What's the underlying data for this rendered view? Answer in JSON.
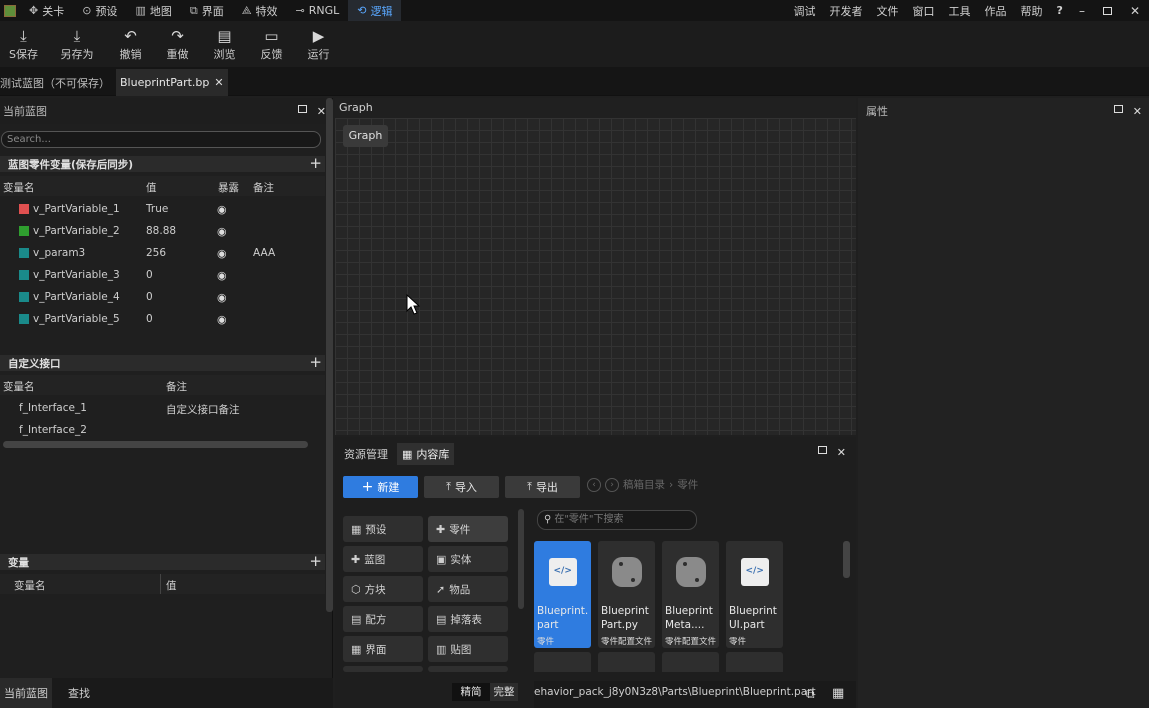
{
  "menubar": {
    "nav": [
      {
        "label": "关卡",
        "icon": "level-icon"
      },
      {
        "label": "预设",
        "icon": "preset-icon"
      },
      {
        "label": "地图",
        "icon": "map-icon"
      },
      {
        "label": "界面",
        "icon": "ui-icon"
      },
      {
        "label": "特效",
        "icon": "effects-icon"
      },
      {
        "label": "RNGL",
        "icon": "rngl-icon"
      },
      {
        "label": "逻辑",
        "icon": "logic-icon"
      }
    ],
    "right": [
      "调试",
      "开发者",
      "文件",
      "窗口",
      "工具",
      "作品",
      "帮助"
    ],
    "help_icon": "?",
    "accent": "#5aa8ff"
  },
  "toolbar": {
    "items": [
      {
        "label": "S保存",
        "icon": "save-icon"
      },
      {
        "label": "另存为",
        "icon": "save-as-icon"
      },
      {
        "label": "撤销",
        "icon": "undo-icon"
      },
      {
        "label": "重做",
        "icon": "redo-icon"
      },
      {
        "label": "浏览",
        "icon": "browse-icon"
      },
      {
        "label": "反馈",
        "icon": "feedback-icon"
      },
      {
        "label": "运行",
        "icon": "run-icon"
      }
    ]
  },
  "doctabs": {
    "tab1": "测试蓝图（不可保存）",
    "tab2": "BlueprintPart.bp"
  },
  "leftpanel": {
    "title": "当前蓝图",
    "search_placeholder": "Search...",
    "part_vars": {
      "title": "蓝图零件变量(保存后同步)",
      "col_name": "变量名",
      "col_value": "值",
      "col_expose": "暴露",
      "col_note": "备注",
      "rows": [
        {
          "name": "v_PartVariable_1",
          "value": "True",
          "note": "",
          "color": "#e05050"
        },
        {
          "name": "v_PartVariable_2",
          "value": "88.88",
          "note": "",
          "color": "#2f9e2f"
        },
        {
          "name": "v_param3",
          "value": "256",
          "note": "AAA",
          "color": "#1a8a8a"
        },
        {
          "name": "v_PartVariable_3",
          "value": "0",
          "note": "",
          "color": "#1a8a8a"
        },
        {
          "name": "v_PartVariable_4",
          "value": "0",
          "note": "",
          "color": "#1a8a8a"
        },
        {
          "name": "v_PartVariable_5",
          "value": "0",
          "note": "",
          "color": "#1a8a8a"
        }
      ]
    },
    "interfaces": {
      "title": "自定义接口",
      "col_name": "变量名",
      "col_note": "备注",
      "rows": [
        {
          "name": "f_Interface_1",
          "note": "自定义接口备注"
        },
        {
          "name": "f_Interface_2",
          "note": ""
        }
      ]
    },
    "variables": {
      "title": "变量",
      "col_name": "变量名",
      "col_value": "值"
    },
    "bottom_tabs": [
      "当前蓝图",
      "查找"
    ]
  },
  "graph": {
    "header": "Graph",
    "chip": "Graph"
  },
  "rightpanel": {
    "title": "属性"
  },
  "assets": {
    "tabs": [
      "资源管理",
      "内容库"
    ],
    "buttons": {
      "new": "新建",
      "import": "导入",
      "export": "导出"
    },
    "breadcrumb": {
      "root": "稿箱目录",
      "current": "零件"
    },
    "search_placeholder": "在\"零件\"下搜索",
    "categories": [
      {
        "label": "预设",
        "icon": "preset-cat-icon"
      },
      {
        "label": "零件",
        "icon": "part-cat-icon"
      },
      {
        "label": "蓝图",
        "icon": "blueprint-cat-icon"
      },
      {
        "label": "实体",
        "icon": "entity-cat-icon"
      },
      {
        "label": "方块",
        "icon": "block-cat-icon"
      },
      {
        "label": "物品",
        "icon": "item-cat-icon"
      },
      {
        "label": "配方",
        "icon": "recipe-cat-icon"
      },
      {
        "label": "掉落表",
        "icon": "loot-cat-icon"
      },
      {
        "label": "界面",
        "icon": "ui-cat-icon"
      },
      {
        "label": "贴图",
        "icon": "texture-cat-icon"
      }
    ],
    "files": [
      {
        "name": "Blueprint.part",
        "type": "零件",
        "kind": "part"
      },
      {
        "name": "BlueprintPart.py",
        "type": "零件配置文件",
        "kind": "py"
      },
      {
        "name": "BlueprintMeta....",
        "type": "零件配置文件",
        "kind": "py"
      },
      {
        "name": "BlueprintUI.part",
        "type": "零件",
        "kind": "part"
      }
    ],
    "view_modes": [
      "精简",
      "完整"
    ],
    "path": "ehavior_pack_j8y0N3z8\\Parts\\Blueprint\\Blueprint.part"
  }
}
